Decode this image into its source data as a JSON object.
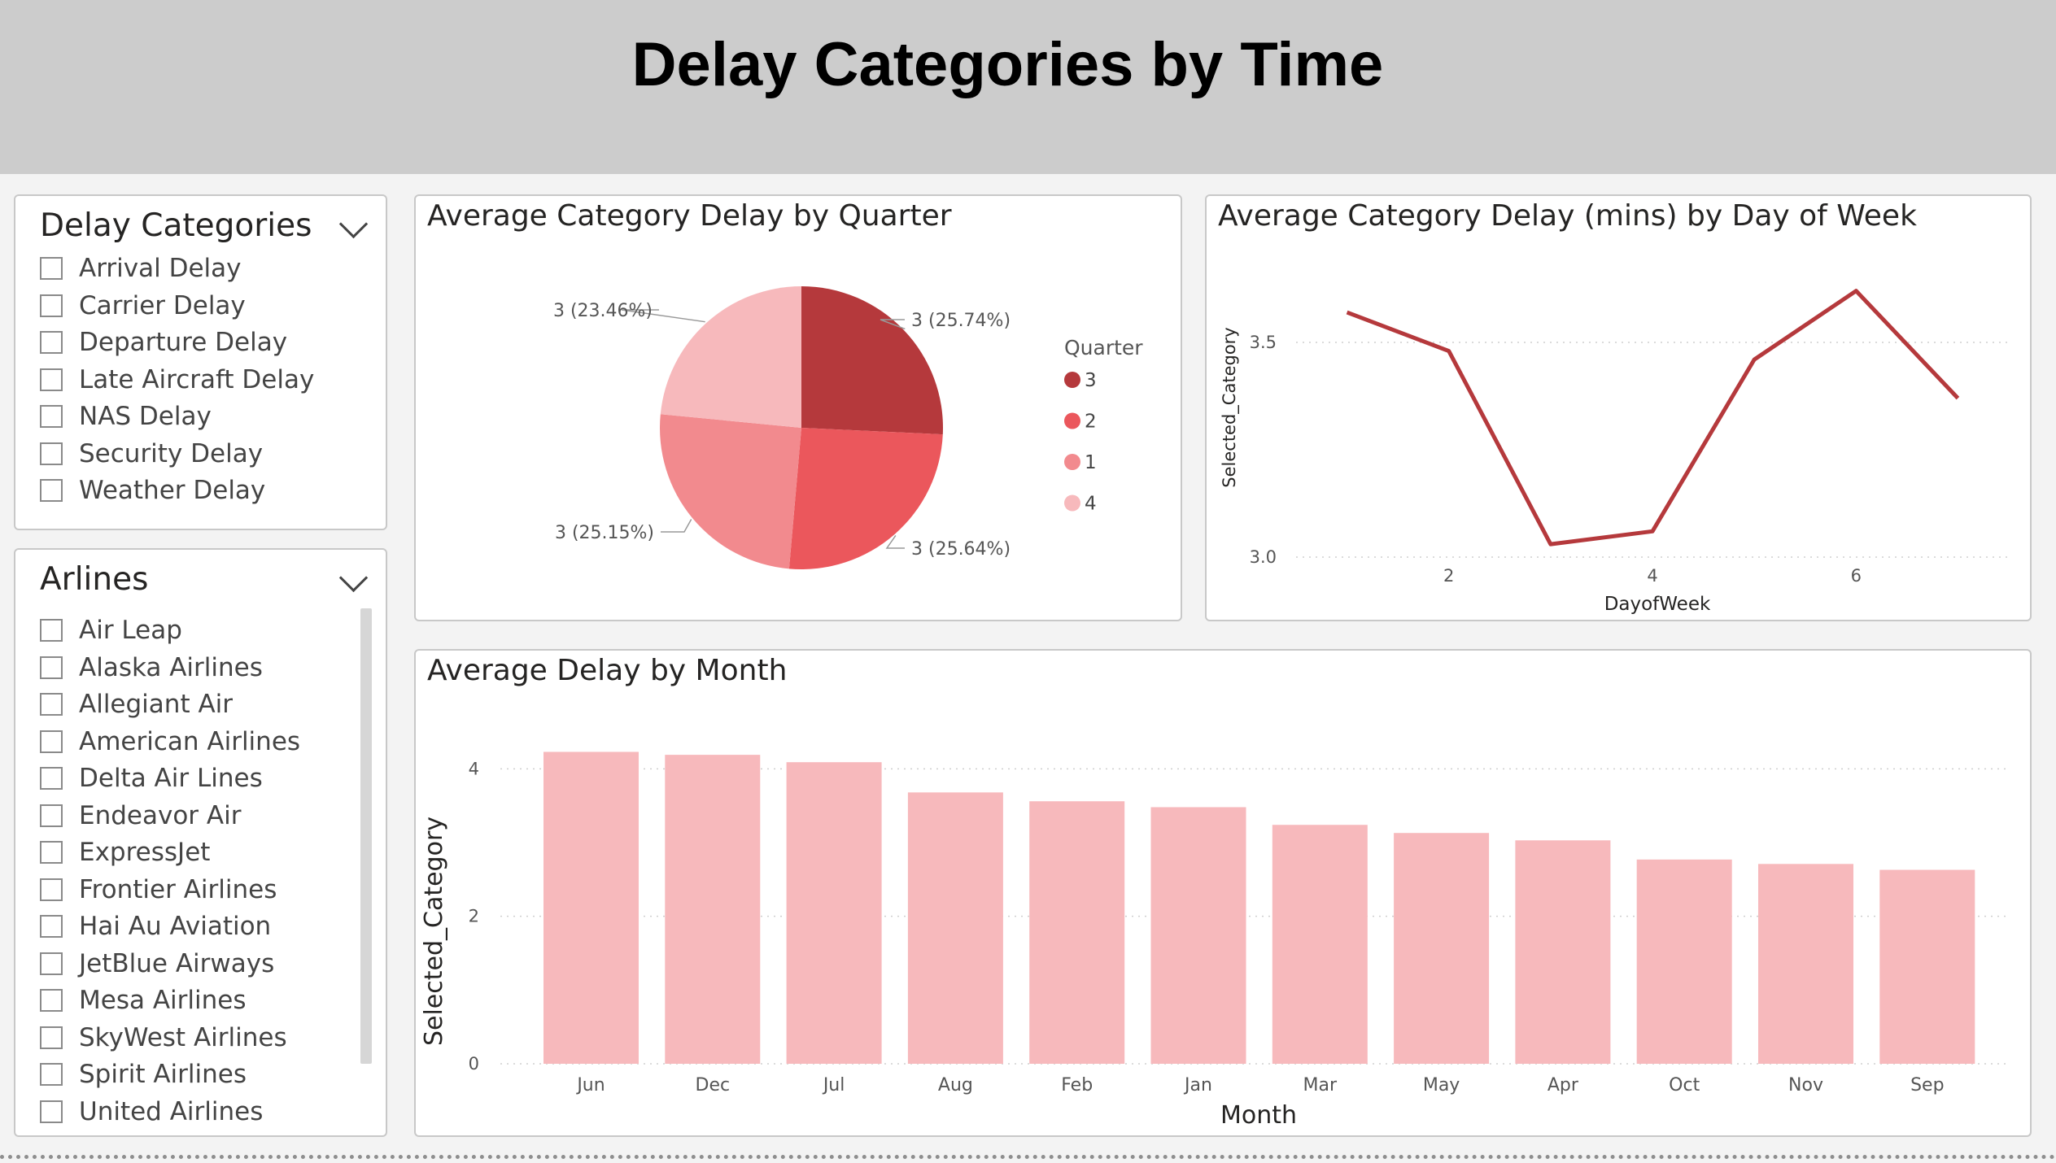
{
  "header": {
    "title": "Delay Categories by Time"
  },
  "slicers": {
    "categories": {
      "title": "Delay Categories",
      "items": [
        "Arrival Delay",
        "Carrier Delay",
        "Departure Delay",
        "Late Aircraft Delay",
        "NAS Delay",
        "Security Delay",
        "Weather Delay"
      ]
    },
    "airlines": {
      "title": "Arlines",
      "items": [
        "Air Leap",
        "Alaska Airlines",
        "Allegiant Air",
        "American Airlines",
        "Delta Air Lines",
        "Endeavor Air",
        "ExpressJet",
        "Frontier Airlines",
        "Hai Au Aviation",
        "JetBlue Airways",
        "Mesa Airlines",
        "SkyWest Airlines",
        "Spirit Airlines",
        "United Airlines"
      ]
    }
  },
  "visuals": {
    "pie": {
      "title": "Average Category Delay by Quarter"
    },
    "line": {
      "title": "Average Category Delay (mins) by Day of Week"
    },
    "bar": {
      "title": "Average Delay by Month"
    }
  },
  "chart_data": [
    {
      "type": "pie",
      "title": "Average Category Delay by Quarter",
      "legend_title": "Quarter",
      "legend_position": "right",
      "slices": [
        {
          "label": "3",
          "value": 3,
          "percent": "25.74%",
          "data_label": "3 (25.74%)",
          "color": "#b5393c"
        },
        {
          "label": "2",
          "value": 3,
          "percent": "25.64%",
          "data_label": "3 (25.64%)",
          "color": "#eb575c"
        },
        {
          "label": "1",
          "value": 3,
          "percent": "25.15%",
          "data_label": "3 (25.15%)",
          "color": "#f28a8e"
        },
        {
          "label": "4",
          "value": 3,
          "percent": "23.46%",
          "data_label": "3 (23.46%)",
          "color": "#f7b9bc"
        }
      ]
    },
    {
      "type": "line",
      "title": "Average Category Delay (mins) by Day of Week",
      "xlabel": "DayofWeek",
      "ylabel": "Selected_Category",
      "x": [
        1,
        2,
        3,
        4,
        5,
        6,
        7
      ],
      "series": [
        {
          "values": [
            3.57,
            3.48,
            3.03,
            3.06,
            3.46,
            3.62,
            3.37
          ],
          "color": "#b5393c"
        }
      ],
      "xlim": [
        0.5,
        7.5
      ],
      "ylim": [
        3.0,
        3.5
      ],
      "xticks": [
        2,
        4,
        6
      ],
      "yticks": [
        3.0,
        3.5
      ],
      "ytick_labels": [
        "3.0",
        "3.5"
      ],
      "grid": true
    },
    {
      "type": "bar",
      "title": "Average Delay by Month",
      "xlabel": "Month",
      "ylabel": "Selected_Category",
      "categories": [
        "Jun",
        "Dec",
        "Jul",
        "Aug",
        "Feb",
        "Jan",
        "Mar",
        "May",
        "Apr",
        "Oct",
        "Nov",
        "Sep"
      ],
      "values": [
        4.23,
        4.19,
        4.09,
        3.68,
        3.56,
        3.48,
        3.24,
        3.13,
        3.03,
        2.77,
        2.71,
        2.63
      ],
      "ylim": [
        0,
        4.5
      ],
      "yticks": [
        0,
        2,
        4
      ],
      "color": "#f7b9bc",
      "grid": true
    }
  ]
}
